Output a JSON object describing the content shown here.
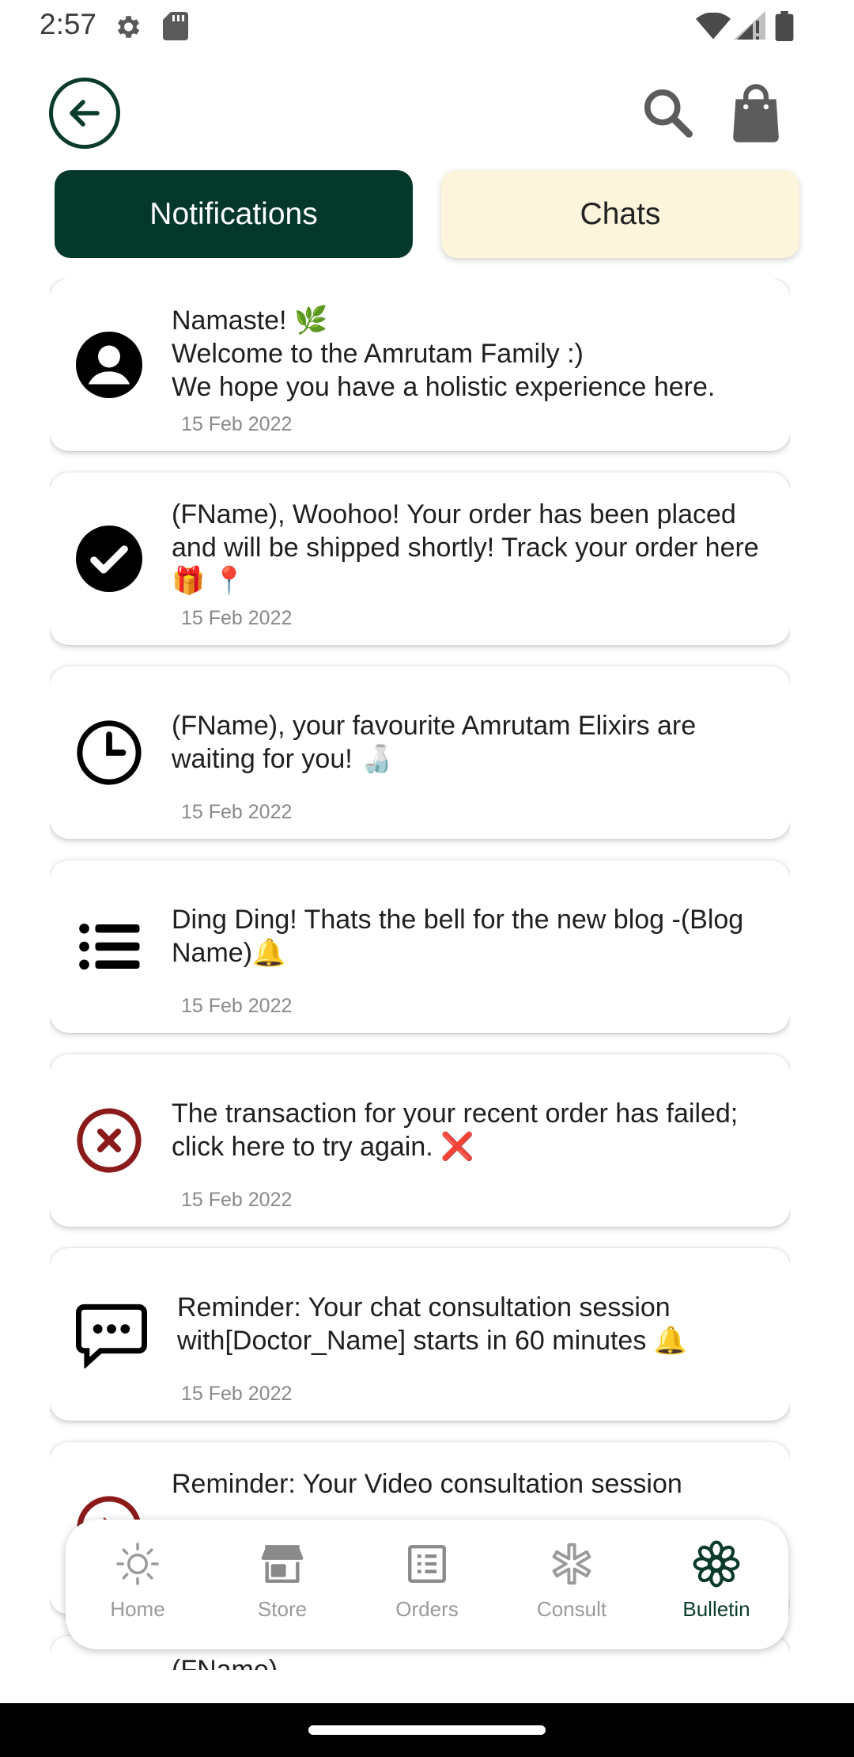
{
  "status_bar": {
    "time": "2:57",
    "icons": [
      "gear-icon",
      "sd-card-icon",
      "wifi-icon",
      "signal-icon",
      "battery-icon"
    ]
  },
  "top_bar": {
    "back_icon": "arrow-left-circle-icon",
    "search_icon": "search-icon",
    "bag_icon": "shopping-bag-icon"
  },
  "tabs": [
    {
      "label": "Notifications",
      "active": true
    },
    {
      "label": "Chats",
      "active": false
    }
  ],
  "notifications": [
    {
      "icon": "user-avatar-icon",
      "text": "Namaste! 🌿\nWelcome to the Amrutam Family :)\nWe hope you have a holistic experience here.",
      "date": "15 Feb 2022"
    },
    {
      "icon": "check-circle-icon",
      "text": "(FName), Woohoo! Your order has been placed and will be shipped shortly! Track your order here 🎁 📍",
      "date": "15 Feb 2022"
    },
    {
      "icon": "clock-icon",
      "text": "(FName), your favourite Amrutam Elixirs are waiting for you! 🍶",
      "date": "15 Feb 2022"
    },
    {
      "icon": "list-icon",
      "text": "Ding Ding! Thats the bell for the new blog -(Blog Name)🔔",
      "date": "15 Feb 2022"
    },
    {
      "icon": "error-circle-icon",
      "text": "The transaction for your recent order has failed; click here to try again. ❌",
      "date": "15 Feb 2022"
    },
    {
      "icon": "chat-bubble-icon",
      "text": "Reminder: Your chat consultation session with[Doctor_Name] starts in 60 minutes 🔔",
      "date": "15 Feb 2022"
    },
    {
      "icon": "video-play-icon",
      "text": "Reminder: Your Video consultation session",
      "date": ""
    },
    {
      "icon": "",
      "text": "(FName)",
      "date": ""
    }
  ],
  "bottom_nav": [
    {
      "label": "Home",
      "icon": "sun-icon",
      "active": false
    },
    {
      "label": "Store",
      "icon": "store-icon",
      "active": false
    },
    {
      "label": "Orders",
      "icon": "orders-list-icon",
      "active": false
    },
    {
      "label": "Consult",
      "icon": "asterisk-icon",
      "active": false
    },
    {
      "label": "Bulletin",
      "icon": "flower-icon",
      "active": true
    }
  ],
  "colors": {
    "primary_green": "#03382a",
    "tab_inactive_bg": "#fdf4dc",
    "error_red": "#8b1a1a",
    "nav_inactive": "#9a9a9a",
    "date_gray": "#8a8a8a"
  }
}
